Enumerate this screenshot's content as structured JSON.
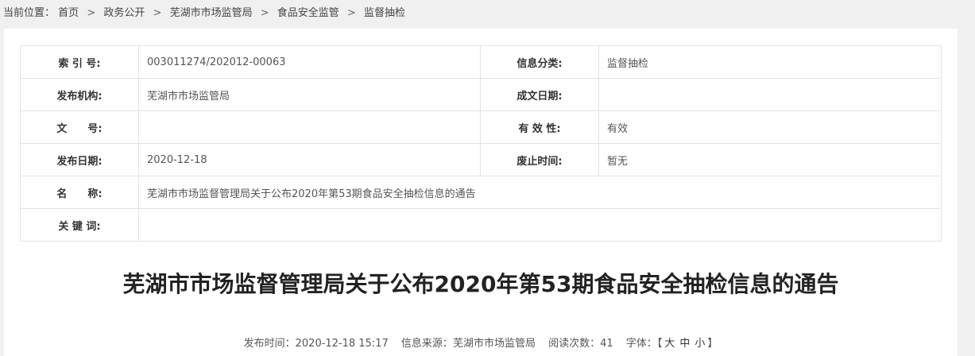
{
  "breadcrumb": {
    "prefix": "当前位置：",
    "items": [
      "首页",
      "政务公开",
      "芜湖市市场监管局",
      "食品安全监管",
      "监督抽检"
    ],
    "separator": ">"
  },
  "meta": {
    "index_label": "索 引 号:",
    "index_value": "003011274/202012-00063",
    "category_label": "信息分类:",
    "category_value": "监督抽检",
    "publisher_label": "发布机构:",
    "publisher_value": "芜湖市市场监管局",
    "written_date_label": "成文日期:",
    "written_date_value": "",
    "doc_no_label": "文　　号:",
    "doc_no_value": "",
    "validity_label": "有 效 性:",
    "validity_value": "有效",
    "publish_date_label": "发布日期:",
    "publish_date_value": "2020-12-18",
    "expire_label": "废止时间:",
    "expire_value": "暂无",
    "name_label": "名　　称:",
    "name_value": "芜湖市市场监督管理局关于公布2020年第53期食品安全抽检信息的通告",
    "keywords_label": "关 键 词:",
    "keywords_value": ""
  },
  "article": {
    "title": "芜湖市市场监督管理局关于公布2020年第53期食品安全抽检信息的通告",
    "publish_time_label": "发布时间：",
    "publish_time": "2020-12-18 15:17",
    "source_label": "信息来源：",
    "source": "芜湖市市场监管局",
    "reads_label": "阅读次数：",
    "reads": "41",
    "font_label": "字体：",
    "font_open": "【",
    "font_large": "大",
    "font_medium": "中",
    "font_small": "小",
    "font_close": "】"
  }
}
